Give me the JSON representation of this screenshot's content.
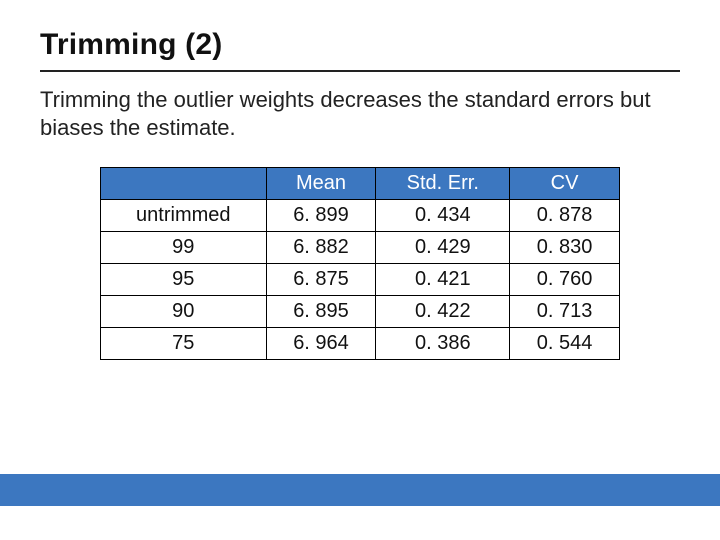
{
  "title": "Trimming (2)",
  "body": "Trimming the outlier weights decreases the standard errors but biases the estimate.",
  "accent_color": "#3c77c0",
  "chart_data": {
    "type": "table",
    "title": "Trimming (2)",
    "columns": [
      "Mean",
      "Std. Err.",
      "CV"
    ],
    "row_labels": [
      "untrimmed",
      "99",
      "95",
      "90",
      "75"
    ],
    "rows": [
      {
        "label": "untrimmed",
        "mean": "6. 899",
        "stderr": "0. 434",
        "cv": "0. 878"
      },
      {
        "label": "99",
        "mean": "6. 882",
        "stderr": "0. 429",
        "cv": "0. 830"
      },
      {
        "label": "95",
        "mean": "6. 875",
        "stderr": "0. 421",
        "cv": "0. 760"
      },
      {
        "label": "90",
        "mean": "6. 895",
        "stderr": "0. 422",
        "cv": "0. 713"
      },
      {
        "label": "75",
        "mean": "6. 964",
        "stderr": "0. 386",
        "cv": "0. 544"
      }
    ]
  }
}
